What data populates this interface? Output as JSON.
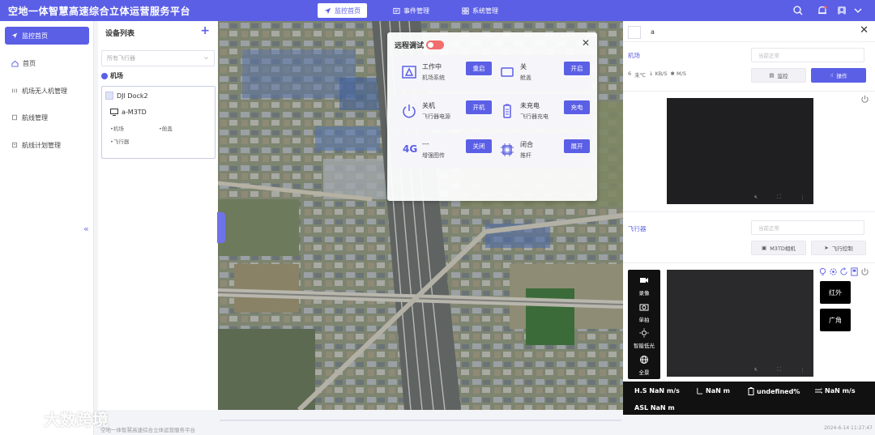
{
  "header": {
    "title": "空地一体智慧高速综合立体运营服务平台",
    "tabs": [
      {
        "label": "监控首页",
        "icon": "navigation-icon",
        "active": true
      },
      {
        "label": "事件管理",
        "icon": "event-icon",
        "active": false
      },
      {
        "label": "系统管理",
        "icon": "grid-icon",
        "active": false
      }
    ],
    "right_icons": [
      "search-icon",
      "bell-icon",
      "avatar-icon",
      "chevron-down-icon"
    ]
  },
  "sidebar": {
    "items": [
      {
        "label": "监控首页",
        "icon": "navigation-icon",
        "active": true
      },
      {
        "label": "首页",
        "icon": "home-icon"
      },
      {
        "label": "机场无人机管理",
        "icon": "list-icon"
      },
      {
        "label": "航线管理",
        "icon": "route-icon"
      },
      {
        "label": "航线计划管理",
        "icon": "plan-icon"
      }
    ],
    "collapse_glyph": "«"
  },
  "device_list": {
    "title": "设备列表",
    "add_glyph": "+",
    "select_placeholder": "所有飞行器",
    "group_label": "机场",
    "dock_name": "DJI Dock2",
    "drone_name": "a-M3TD",
    "tags": [
      "机场",
      "舱盖",
      "飞行器"
    ]
  },
  "modal": {
    "title": "远程调试",
    "close_glyph": "✕",
    "cards": [
      {
        "status": "工作中",
        "sub": "机场系统",
        "button": "重启",
        "icon": "system-icon"
      },
      {
        "status": "关",
        "sub": "舱盖",
        "button": "开启",
        "icon": "cover-icon"
      },
      {
        "status": "关机",
        "sub": "飞行器电源",
        "button": "开机",
        "icon": "power-icon"
      },
      {
        "status": "未充电",
        "sub": "飞行器充电",
        "button": "充电",
        "icon": "battery-icon"
      },
      {
        "status": "---",
        "sub": "增强图传",
        "button": "关闭",
        "icon": "4g-icon",
        "icon_text": "4G"
      },
      {
        "status": "闭合",
        "sub": "推杆",
        "button": "展开",
        "icon": "putter-icon"
      }
    ]
  },
  "right_panel": {
    "name": "a",
    "close_glyph": "✕",
    "airport": {
      "label": "机场",
      "status_placeholder": "当前正常",
      "stats": [
        "6",
        "未℃",
        "↓ KB/S",
        "✱ M/S"
      ],
      "monitor_button": "监控",
      "operate_button": "操作"
    },
    "aircraft": {
      "label": "飞行器",
      "status_placeholder": "当前正常",
      "camera_button": "M3TD相机",
      "control_button": "飞行控制"
    },
    "camera_tools": [
      {
        "label": "录像",
        "icon": "video-icon"
      },
      {
        "label": "单拍",
        "icon": "camera-icon"
      },
      {
        "label": "智能低光",
        "icon": "sun-icon"
      },
      {
        "label": "全景",
        "icon": "globe-icon"
      }
    ],
    "modes": [
      "红外",
      "广角"
    ],
    "telemetry": {
      "hs": "H.S NaN m/s",
      "height": "NaN m",
      "battery": "undefined%",
      "wind": "NaN m/s",
      "asl": "ASL NaN m"
    }
  },
  "footer": {
    "left": "空地一体智慧高速综合立体运营服务平台",
    "right": "2024-6-14 11:27:47",
    "watermark": "大数跨境"
  },
  "colors": {
    "accent": "#5b5fe6",
    "toggle_off": "#f26d6d"
  }
}
